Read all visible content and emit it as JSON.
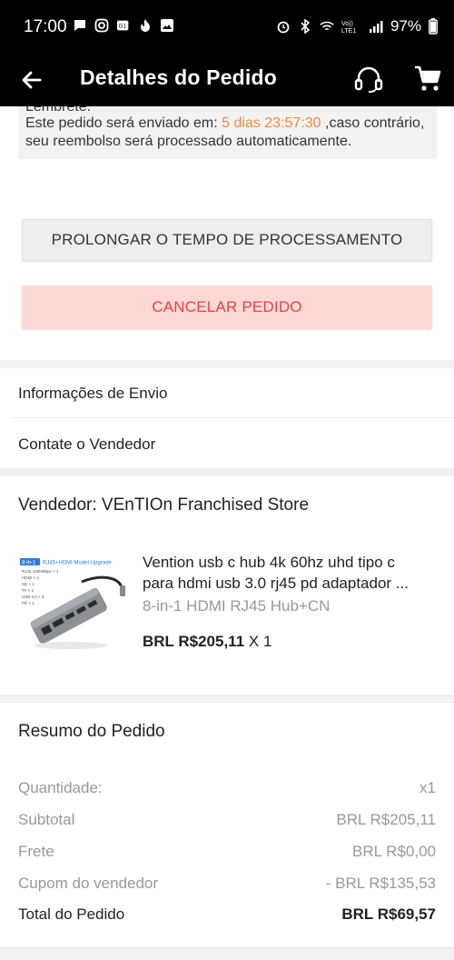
{
  "status_bar": {
    "time": "17:00",
    "battery": "97%",
    "volte_label": "Vo)) LTE1"
  },
  "app_bar": {
    "title": "Detalhes do Pedido"
  },
  "reminder": {
    "title": "Lembrete:",
    "text_before": "Este pedido será enviado em: ",
    "countdown": "5 dias 23:57:30",
    "text_after": " ,caso contrário, seu reembolso será processado automaticamente."
  },
  "actions": {
    "prolong_label": "PROLONGAR O TEMPO DE PROCESSAMENTO",
    "cancel_label": "CANCELAR PEDIDO"
  },
  "links": {
    "shipping_info": "Informações de Envio",
    "contact_seller": "Contate o Vendedor"
  },
  "seller": {
    "name": "Vendedor: VEnTIOn Franchised Store"
  },
  "product": {
    "title_line1": "Vention usb c hub 4k 60hz uhd tipo c",
    "title_line2": "para hdmi usb 3.0 rj45 pd adaptador ...",
    "variant": "8-in-1 HDMI RJ45 Hub+CN",
    "price": "BRL R$205,11",
    "quantity": " X 1",
    "thumb_badge": "8-in-1",
    "thumb_caption": "RJ45+HDMI Model-Upgrade",
    "thumb_specs": [
      "RJ45 1000Mbps × 1",
      "HDMI × 1",
      "SD × 1",
      "TF × 1",
      "USB 3.0 × 3",
      "PD × 1"
    ]
  },
  "summary": {
    "title": "Resumo do Pedido",
    "rows": [
      {
        "label": "Quantidade:",
        "value": "x1"
      },
      {
        "label": "Subtotal",
        "value": "BRL R$205,11"
      },
      {
        "label": "Frete",
        "value": "BRL R$0,00"
      },
      {
        "label": "Cupom do vendedor",
        "value": "- BRL R$135,53"
      }
    ],
    "total_label": "Total do Pedido",
    "total_value": "BRL R$69,57"
  },
  "colors": {
    "countdown": "#f08c3e",
    "cancel_text": "#e64340",
    "cancel_bg": "#ffd8d6",
    "app_bar_bg": "#000000"
  }
}
